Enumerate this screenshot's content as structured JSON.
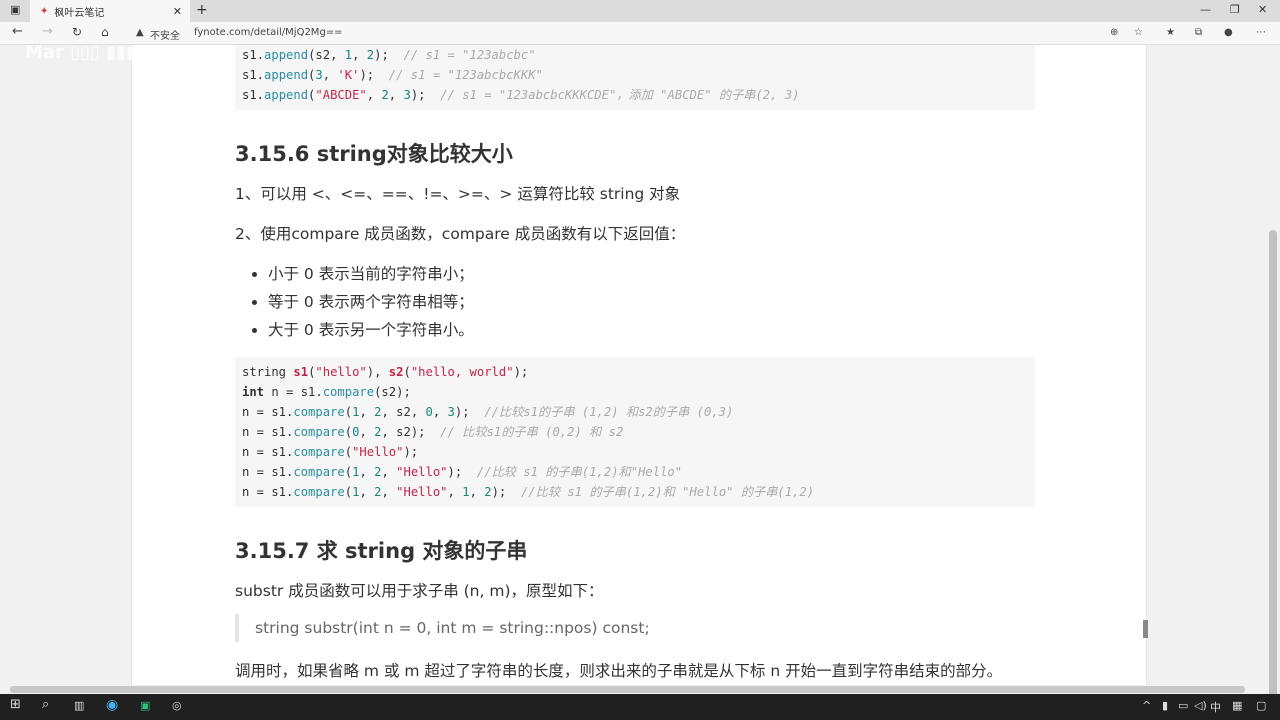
{
  "browser": {
    "tab_title": "枫叶云笔记",
    "insecure_label": "不安全",
    "url": "fynote.com/detail/MjQ2Mg==",
    "watermark": "Mar 议客室"
  },
  "code_top": [
    [
      [
        "s1",
        ""
      ],
      [
        ".",
        ""
      ],
      [
        "append",
        "fn"
      ],
      [
        "(s2, ",
        ""
      ],
      [
        "1",
        "nu"
      ],
      [
        ", ",
        ""
      ],
      [
        "2",
        "nu"
      ],
      [
        ");  ",
        ""
      ],
      [
        "// s1 = \"123abcbc\"",
        "cm"
      ]
    ],
    [
      [
        "s1.",
        ""
      ],
      [
        "append",
        "fn"
      ],
      [
        "(",
        ""
      ],
      [
        "3",
        "nu"
      ],
      [
        ", ",
        ""
      ],
      [
        "'K'",
        "st"
      ],
      [
        ");  ",
        ""
      ],
      [
        "// s1 = \"123abcbcKKK\"",
        "cm"
      ]
    ],
    [
      [
        "s1.",
        ""
      ],
      [
        "append",
        "fn"
      ],
      [
        "(",
        ""
      ],
      [
        "\"ABCDE\"",
        "st"
      ],
      [
        ", ",
        ""
      ],
      [
        "2",
        "nu"
      ],
      [
        ", ",
        ""
      ],
      [
        "3",
        "nu"
      ],
      [
        ");  ",
        ""
      ],
      [
        "// s1 = \"123abcbcKKKCDE\"，添加 \"ABCDE\" 的子串(2, 3)",
        "cm"
      ]
    ]
  ],
  "section1": {
    "heading": "3.15.6 string对象比较大小",
    "p1": "1、可以用 <、<=、==、!=、>=、> 运算符比较 string 对象",
    "p2": "2、使用compare 成员函数，compare 成员函数有以下返回值：",
    "bullets": [
      "小于 0 表示当前的字符串小；",
      "等于 0 表示两个字符串相等；",
      "大于 0 表示另一个字符串小。"
    ]
  },
  "code_compare": [
    [
      [
        "string ",
        ""
      ],
      [
        "s1",
        "nm"
      ],
      [
        "(",
        ""
      ],
      [
        "\"hello\"",
        "st"
      ],
      [
        "), ",
        ""
      ],
      [
        "s2",
        "nm"
      ],
      [
        "(",
        ""
      ],
      [
        "\"hello, world\"",
        "st"
      ],
      [
        ");",
        ""
      ]
    ],
    [
      [
        "int",
        "kw"
      ],
      [
        " n = s1.",
        ""
      ],
      [
        "compare",
        "fn"
      ],
      [
        "(s2);",
        ""
      ]
    ],
    [
      [
        "n = s1.",
        ""
      ],
      [
        "compare",
        "fn"
      ],
      [
        "(",
        ""
      ],
      [
        "1",
        "nu"
      ],
      [
        ", ",
        ""
      ],
      [
        "2",
        "nu"
      ],
      [
        ", s2, ",
        ""
      ],
      [
        "0",
        "nu"
      ],
      [
        ", ",
        ""
      ],
      [
        "3",
        "nu"
      ],
      [
        ");  ",
        ""
      ],
      [
        "//比较s1的子串 (1,2) 和s2的子串 (0,3)",
        "cm"
      ]
    ],
    [
      [
        "n = s1.",
        ""
      ],
      [
        "compare",
        "fn"
      ],
      [
        "(",
        ""
      ],
      [
        "0",
        "nu"
      ],
      [
        ", ",
        ""
      ],
      [
        "2",
        "nu"
      ],
      [
        ", s2);  ",
        ""
      ],
      [
        "// 比较s1的子串 (0,2) 和 s2",
        "cm"
      ]
    ],
    [
      [
        "n = s1.",
        ""
      ],
      [
        "compare",
        "fn"
      ],
      [
        "(",
        ""
      ],
      [
        "\"Hello\"",
        "st"
      ],
      [
        ");",
        ""
      ]
    ],
    [
      [
        "n = s1.",
        ""
      ],
      [
        "compare",
        "fn"
      ],
      [
        "(",
        ""
      ],
      [
        "1",
        "nu"
      ],
      [
        ", ",
        ""
      ],
      [
        "2",
        "nu"
      ],
      [
        ", ",
        ""
      ],
      [
        "\"Hello\"",
        "st"
      ],
      [
        ");  ",
        ""
      ],
      [
        "//比较 s1 的子串(1,2)和\"Hello\"",
        "cm"
      ]
    ],
    [
      [
        "n = s1.",
        ""
      ],
      [
        "compare",
        "fn"
      ],
      [
        "(",
        ""
      ],
      [
        "1",
        "nu"
      ],
      [
        ", ",
        ""
      ],
      [
        "2",
        "nu"
      ],
      [
        ", ",
        ""
      ],
      [
        "\"Hello\"",
        "st"
      ],
      [
        ", ",
        ""
      ],
      [
        "1",
        "nu"
      ],
      [
        ", ",
        ""
      ],
      [
        "2",
        "nu"
      ],
      [
        ");  ",
        ""
      ],
      [
        "//比较 s1 的子串(1,2)和 \"Hello\" 的子串(1,2)",
        "cm"
      ]
    ]
  ],
  "section2": {
    "heading": "3.15.7 求 string 对象的子串",
    "p1": "substr 成员函数可以用于求子串 (n, m)，原型如下：",
    "quote": "string substr(int n = 0, int m = string::npos) const;",
    "p2": "调用时，如果省略 m 或 m 超过了字符串的长度，则求出来的子串就是从下标 n 开始一直到字符串结束的部分。"
  },
  "taskbar": {
    "ime": "中"
  }
}
